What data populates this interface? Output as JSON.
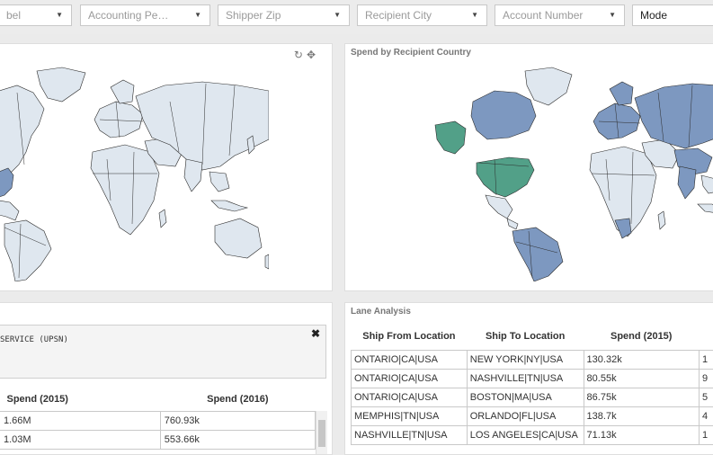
{
  "filters": [
    {
      "label": "bel",
      "dark": false
    },
    {
      "label": "Accounting Pe…",
      "dark": false
    },
    {
      "label": "Shipper Zip",
      "dark": false
    },
    {
      "label": "Recipient City",
      "dark": false
    },
    {
      "label": "Account Number",
      "dark": false
    },
    {
      "label": "Mode",
      "dark": true
    }
  ],
  "left_map": {
    "tools": [
      "refresh-icon",
      "move-icon"
    ]
  },
  "right_map": {
    "title": "Spend by Recipient Country"
  },
  "colors": {
    "light": "#dfe7ef",
    "blue": "#7d98c0",
    "green": "#52a088"
  },
  "detail": {
    "text": "SERVICE (UPSN)",
    "close": "✖"
  },
  "left_table": {
    "headers": [
      "Spend (2015)",
      "Spend (2016)"
    ],
    "rows": [
      [
        "1.66M",
        "760.93k"
      ],
      [
        "1.03M",
        "553.66k"
      ]
    ]
  },
  "lane": {
    "title": "Lane Analysis",
    "headers": [
      "Ship From Location",
      "Ship To Location",
      "Spend (2015)",
      ""
    ],
    "rows": [
      [
        "ONTARIO|CA|USA",
        "NEW YORK|NY|USA",
        "130.32k",
        "1"
      ],
      [
        "ONTARIO|CA|USA",
        "NASHVILLE|TN|USA",
        "80.55k",
        "9"
      ],
      [
        "ONTARIO|CA|USA",
        "BOSTON|MA|USA",
        "86.75k",
        "5"
      ],
      [
        "MEMPHIS|TN|USA",
        "ORLANDO|FL|USA",
        "138.7k",
        "4"
      ],
      [
        "NASHVILLE|TN|USA",
        "LOS ANGELES|CA|USA",
        "71.13k",
        "1"
      ]
    ]
  }
}
